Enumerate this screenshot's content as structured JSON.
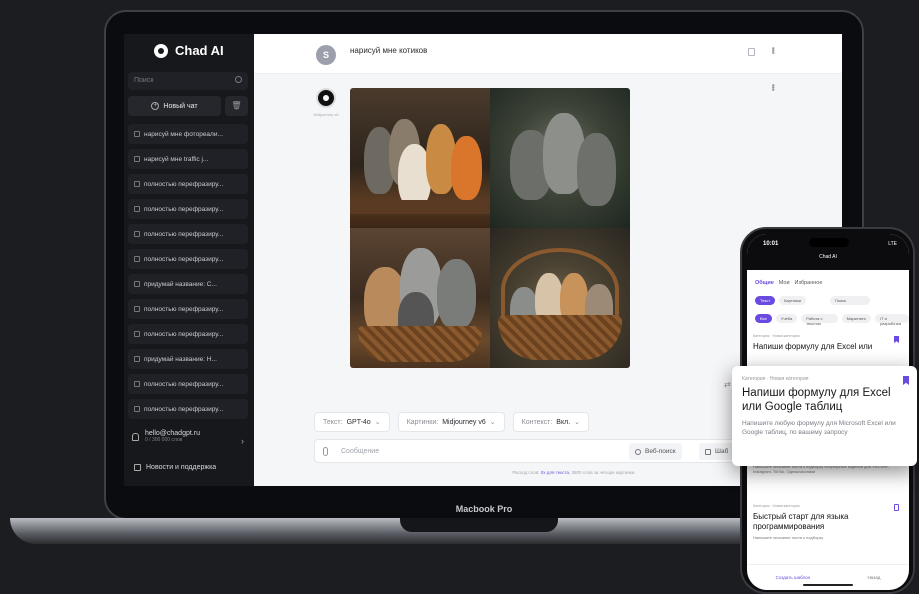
{
  "device": {
    "laptop_label": "Macbook Pro"
  },
  "app": {
    "name": "Chad AI"
  },
  "sidebar": {
    "search_placeholder": "Поиск",
    "new_chat": "Новый чат",
    "chats": [
      "нарисуй мне фотореали...",
      "нарисуй мне traffic j...",
      "полностью перефразиру...",
      "полностью перефразиру...",
      "полностью перефразиру...",
      "полностью перефразиру...",
      "придумай название: С...",
      "полностью перефразиру...",
      "полностью перефразиру...",
      "придумай название: Н...",
      "полностью перефразиру...",
      "полностью перефразиру..."
    ],
    "account_email": "hello@chadgpt.ru",
    "account_words": "0 / 300 000 слов",
    "news": "Новости и поддержка"
  },
  "chat": {
    "user_avatar": "S",
    "user_message": "нарисуй мне котиков",
    "bot_name": "Midjourney v6",
    "colors": {
      "accent": "#6a4ae0"
    }
  },
  "composer": {
    "text_model_label": "Текст:",
    "text_model_value": "GPT-4o",
    "image_model_label": "Картинки:",
    "image_model_value": "Midjourney v6",
    "context_label": "Контекст:",
    "context_value": "Вкл.",
    "placeholder": "Сообщение",
    "web_search": "Веб-поиск",
    "templates": "Шаб",
    "footnote_pre": "Расход слов:",
    "footnote_link": "0х для текста",
    "footnote_post": ", 3800 слов за четыре картинки."
  },
  "phone": {
    "time": "10:01",
    "status": "LTE",
    "brand": "Chad AI",
    "tabs": [
      "Общие",
      "Мои",
      "Избранное"
    ],
    "row2": [
      "Текст",
      "Картинки",
      "Поиск"
    ],
    "filters": [
      "Все",
      "Учёба",
      "Работа с текстом",
      "Маркетинг",
      "IT и разработка"
    ],
    "card1_meta": "Категория · Новая категория",
    "card1_title": "Напиши формулу для Excel или",
    "below_desc": "Напишите описание поста к подборку популярных изделий для YouTube, Instagram, TikTok, Одноклассники",
    "card2_meta": "Категория · Новая категория",
    "card2_title": "Быстрый старт для языка программирования",
    "card2_desc": "Напишите описание поста к подборку",
    "bottom": [
      "Создать шаблон",
      "Назад"
    ]
  },
  "popup": {
    "meta": "Категория · Новая категория",
    "title": "Напиши формулу для Excel или Google таблиц",
    "desc": "Напишите любую формулу для Microsoft Excel или Google таблиц, по вашему запросу"
  }
}
